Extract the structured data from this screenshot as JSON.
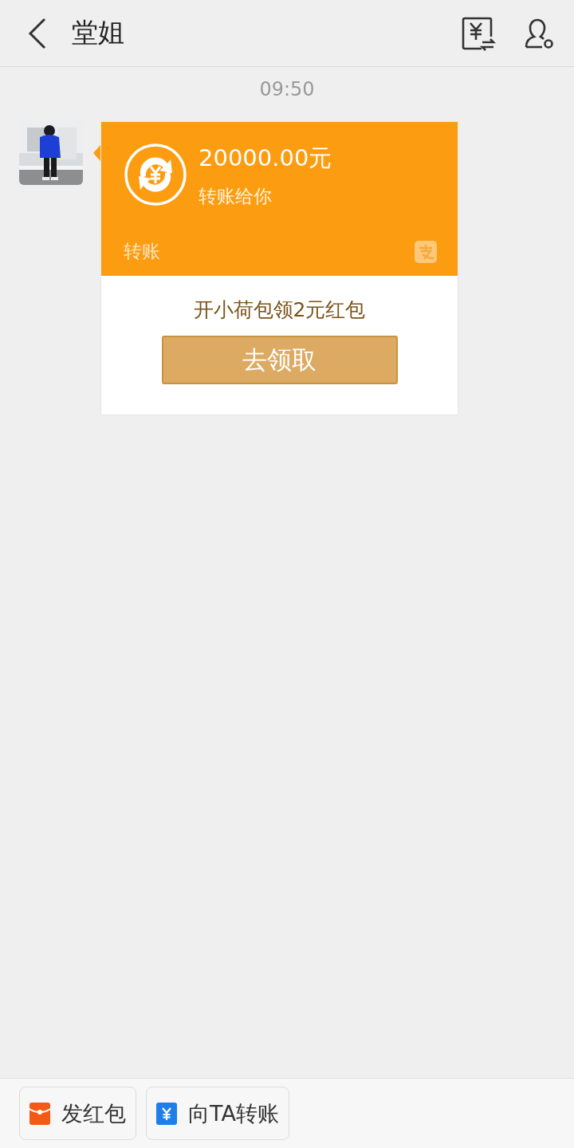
{
  "header": {
    "title": "堂姐"
  },
  "messages": [
    {
      "time": "09:50",
      "kind": "transfer",
      "amount": "20000.00元",
      "caption": "转账给你",
      "footer_label": "转账",
      "promo_text": "开小荷包领2元红包",
      "promo_button": "去领取"
    }
  ],
  "bottom_bar": {
    "buttons": [
      {
        "kind": "red-packet",
        "label": "发红包"
      },
      {
        "kind": "transfer",
        "label": "向TA转账"
      }
    ]
  }
}
